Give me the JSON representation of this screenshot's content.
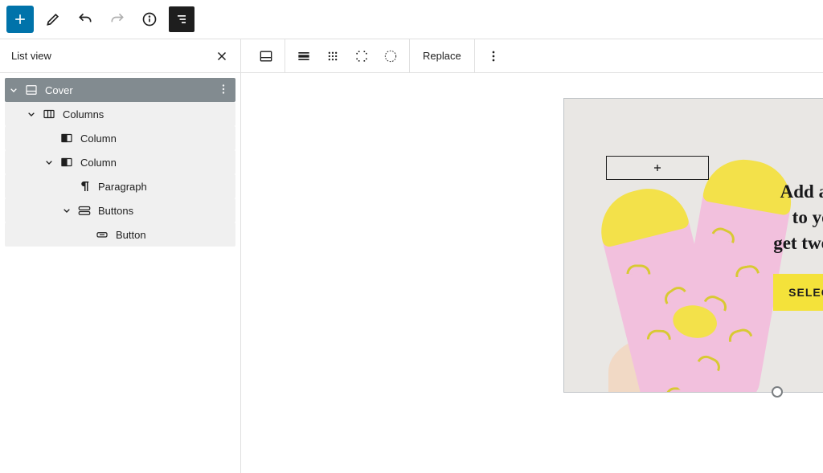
{
  "top": {
    "icons": {
      "inserter": "plus-icon",
      "tools": "pencil-icon",
      "undo": "undo-icon",
      "redo": "redo-icon",
      "info": "info-icon",
      "listview": "list-view-icon"
    }
  },
  "sidebar": {
    "title": "List view",
    "tree": {
      "cover": "Cover",
      "columns": "Columns",
      "column1": "Column",
      "column2": "Column",
      "paragraph": "Paragraph",
      "buttons": "Buttons",
      "button": "Button"
    }
  },
  "block_toolbar": {
    "replace": "Replace"
  },
  "cover": {
    "headline_l1": "Add a pair of socks",
    "headline_l2": "to your cart and",
    "headline_l3": "get two more for free",
    "cta": "SELECT COLOR"
  },
  "colors": {
    "accent_yellow": "#f4e23a",
    "sock_pink": "#f2c0dd",
    "selected_row": "#828b90"
  }
}
